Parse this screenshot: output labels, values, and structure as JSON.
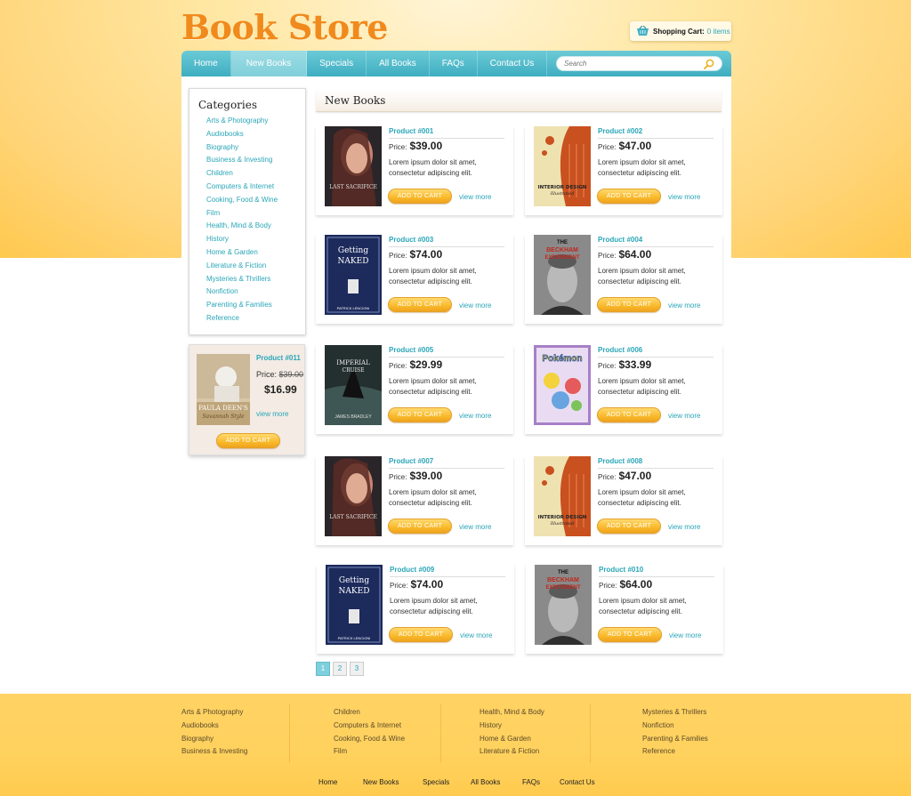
{
  "logo": "Book Store",
  "cart": {
    "label": "Shopping Cart:",
    "count": "0 items",
    "icon": "basket-icon"
  },
  "nav": {
    "items": [
      "Home",
      "New Books",
      "Specials",
      "All Books",
      "FAQs",
      "Contact Us"
    ],
    "active": "New Books"
  },
  "search": {
    "placeholder": "Search"
  },
  "categories": {
    "title": "Categories",
    "items": [
      "Arts & Photography",
      "Audiobooks",
      "Biography",
      "Business & Investing",
      "Children",
      "Computers & Internet",
      "Cooking, Food & Wine",
      "Film",
      "Health, Mind & Body",
      "History",
      "Home & Garden",
      "Literature & Fiction",
      "Mysteries & Thrillers",
      "Nonfiction",
      "Parenting & Families",
      "Reference"
    ]
  },
  "featured": {
    "name": "Product #011",
    "old_price_label": "Price:",
    "old_price": "$39.00",
    "new_price": "$16.99",
    "view_more": "view more",
    "add_to_cart": "ADD TO CART",
    "cover_text": "PAULA DEEN'S Savannah Style"
  },
  "section_title": "New Books",
  "products": [
    {
      "name": "Product #001",
      "price_label": "Price:",
      "price": "$39.00",
      "desc": "Lorem ipsum dolor sit amet, consectetur adipiscing elit.",
      "add_to_cart": "ADD TO CART",
      "view_more": "view more",
      "cover_text": "LAST SACRIFICE"
    },
    {
      "name": "Product #002",
      "price_label": "Price:",
      "price": "$47.00",
      "desc": "Lorem ipsum dolor sit amet, consectetur adipiscing elit.",
      "add_to_cart": "ADD TO CART",
      "view_more": "view more",
      "cover_text": "INTERIOR DESIGN Illustrated"
    },
    {
      "name": "Product #003",
      "price_label": "Price:",
      "price": "$74.00",
      "desc": "Lorem ipsum dolor sit amet, consectetur adipiscing elit.",
      "add_to_cart": "ADD TO CART",
      "view_more": "view more",
      "cover_text": "Getting NAKED"
    },
    {
      "name": "Product #004",
      "price_label": "Price:",
      "price": "$64.00",
      "desc": "Lorem ipsum dolor sit amet, consectetur adipiscing elit.",
      "add_to_cart": "ADD TO CART",
      "view_more": "view more",
      "cover_text": "THE BECKHAM EXPERIMENT"
    },
    {
      "name": "Product #005",
      "price_label": "Price:",
      "price": "$29.99",
      "desc": "Lorem ipsum dolor sit amet, consectetur adipiscing elit.",
      "add_to_cart": "ADD TO CART",
      "view_more": "view more",
      "cover_text": "THE IMPERIAL CRUISE"
    },
    {
      "name": "Product #006",
      "price_label": "Price:",
      "price": "$33.99",
      "desc": "Lorem ipsum dolor sit amet, consectetur adipiscing elit.",
      "add_to_cart": "ADD TO CART",
      "view_more": "view more",
      "cover_text": "Pokémon"
    },
    {
      "name": "Product #007",
      "price_label": "Price:",
      "price": "$39.00",
      "desc": "Lorem ipsum dolor sit amet, consectetur adipiscing elit.",
      "add_to_cart": "ADD TO CART",
      "view_more": "view more",
      "cover_text": "LAST SACRIFICE"
    },
    {
      "name": "Product #008",
      "price_label": "Price:",
      "price": "$47.00",
      "desc": "Lorem ipsum dolor sit amet, consectetur adipiscing elit.",
      "add_to_cart": "ADD TO CART",
      "view_more": "view more",
      "cover_text": "INTERIOR DESIGN Illustrated"
    },
    {
      "name": "Product #009",
      "price_label": "Price:",
      "price": "$74.00",
      "desc": "Lorem ipsum dolor sit amet, consectetur adipiscing elit.",
      "add_to_cart": "ADD TO CART",
      "view_more": "view more",
      "cover_text": "Getting NAKED"
    },
    {
      "name": "Product #010",
      "price_label": "Price:",
      "price": "$64.00",
      "desc": "Lorem ipsum dolor sit amet, consectetur adipiscing elit.",
      "add_to_cart": "ADD TO CART",
      "view_more": "view more",
      "cover_text": "THE BECKHAM EXPERIMENT"
    }
  ],
  "pagination": {
    "pages": [
      "1",
      "2",
      "3"
    ],
    "current": "1"
  },
  "footer": {
    "columns": [
      [
        "Arts & Photography",
        "Audiobooks",
        "Biography",
        "Business & Investing"
      ],
      [
        "Children",
        "Computers & Internet",
        "Cooking, Food & Wine",
        "Film"
      ],
      [
        "Health, Mind & Body",
        "History",
        "Home & Garden",
        "Literature & Fiction"
      ],
      [
        "Mysteries & Thrillers",
        "Nonfiction",
        "Parenting & Families",
        "Reference"
      ]
    ],
    "nav": [
      "Home",
      "New Books",
      "Specials",
      "All Books",
      "FAQs",
      "Contact Us"
    ]
  },
  "colors": {
    "accent": "#2aa6b8",
    "logo": "#f08a1d",
    "button": "#f9b92a",
    "footer_bg": "#ffd15d"
  }
}
